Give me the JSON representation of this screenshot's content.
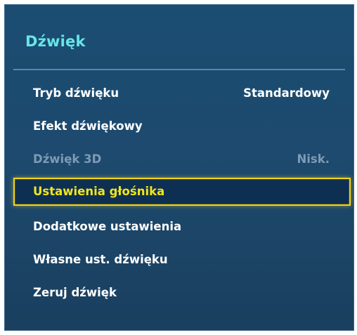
{
  "menu": {
    "title": "Dźwięk",
    "items": [
      {
        "label": "Tryb dźwięku",
        "value": "Standardowy",
        "state": "normal"
      },
      {
        "label": "Efekt dźwiękowy",
        "value": "",
        "state": "normal"
      },
      {
        "label": "Dźwięk 3D",
        "value": "Nisk.",
        "state": "disabled"
      },
      {
        "label": "Ustawienia głośnika",
        "value": "",
        "state": "selected"
      },
      {
        "label": "Dodatkowe ustawienia",
        "value": "",
        "state": "normal"
      },
      {
        "label": "Własne ust. dźwięku",
        "value": "",
        "state": "normal"
      },
      {
        "label": "Zeruj dźwięk",
        "value": "",
        "state": "normal"
      }
    ]
  },
  "colors": {
    "panel_background": "#1d4a6e",
    "title_color": "#67e5e8",
    "selection_border": "#f4d416",
    "selected_text": "#f2e51b",
    "disabled_text": "#7d9bb5"
  }
}
